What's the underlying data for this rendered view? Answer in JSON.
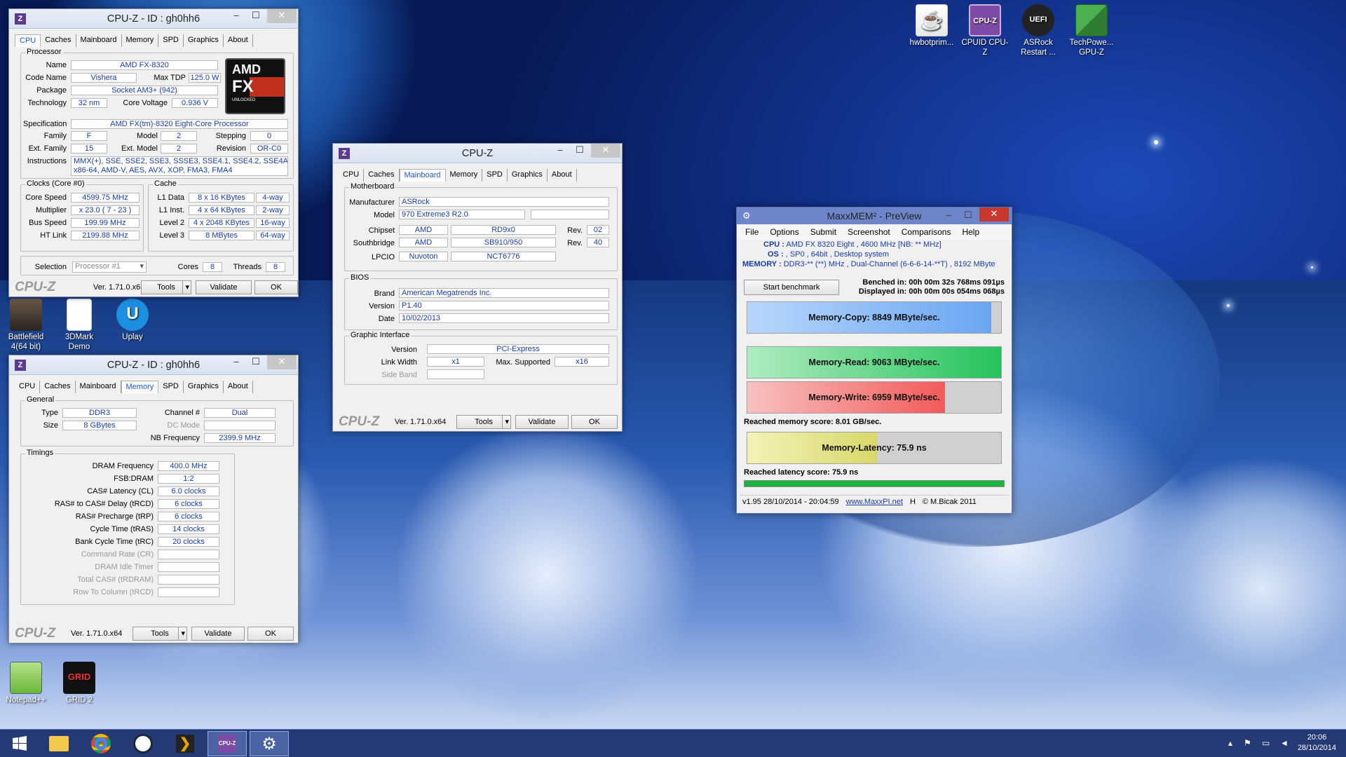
{
  "desktop": {
    "icons_top": [
      {
        "label": "hwbotprim...",
        "icon": "java-icon"
      },
      {
        "label": "CPUID CPU-Z",
        "icon": "cpuz-icon"
      },
      {
        "label": "ASRock Restart ...",
        "icon": "uefi-icon"
      },
      {
        "label": "TechPowe... GPU-Z",
        "icon": "gpuz-icon"
      }
    ],
    "icons_left": [
      {
        "label": "Battlefield 4(64 bit)",
        "icon": "battlefield-icon"
      },
      {
        "label": "3DMark Demo",
        "icon": "document-icon"
      },
      {
        "label": "Uplay",
        "icon": "uplay-icon"
      },
      {
        "label": "Notepad++",
        "icon": "notepad-icon"
      },
      {
        "label": "GRID 2",
        "icon": "grid2-icon"
      }
    ]
  },
  "cpuz_cpu": {
    "title": "CPU-Z  -  ID : gh0hh6",
    "tabs": [
      "CPU",
      "Caches",
      "Mainboard",
      "Memory",
      "SPD",
      "Graphics",
      "About"
    ],
    "active_tab": "CPU",
    "processor_group": "Processor",
    "name_label": "Name",
    "name": "AMD FX-8320",
    "code_name_label": "Code Name",
    "code_name": "Vishera",
    "max_tdp_label": "Max TDP",
    "max_tdp": "125.0 W",
    "package_label": "Package",
    "package": "Socket AM3+ (942)",
    "technology_label": "Technology",
    "technology": "32 nm",
    "core_voltage_label": "Core Voltage",
    "core_voltage": "0.936 V",
    "specification_label": "Specification",
    "specification": "AMD FX(tm)-8320 Eight-Core Processor",
    "family_label": "Family",
    "family": "F",
    "model_label": "Model",
    "model": "2",
    "stepping_label": "Stepping",
    "stepping": "0",
    "ext_family_label": "Ext. Family",
    "ext_family": "15",
    "ext_model_label": "Ext. Model",
    "ext_model": "2",
    "revision_label": "Revision",
    "revision": "OR-C0",
    "instructions_label": "Instructions",
    "instructions_line1": "MMX(+), SSE, SSE2, SSE3, SSSE3, SSE4.1, SSE4.2, SSE4A,",
    "instructions_line2": "x86-64, AMD-V, AES, AVX, XOP, FMA3, FMA4",
    "clocks_group": "Clocks (Core #0)",
    "core_speed_label": "Core Speed",
    "core_speed": "4599.75 MHz",
    "multiplier_label": "Multiplier",
    "multiplier": "x 23.0 ( 7 - 23 )",
    "bus_speed_label": "Bus Speed",
    "bus_speed": "199.99 MHz",
    "ht_link_label": "HT Link",
    "ht_link": "2199.88 MHz",
    "cache_group": "Cache",
    "l1d_label": "L1 Data",
    "l1d": "8 x 16 KBytes",
    "l1d_way": "4-way",
    "l1i_label": "L1 Inst.",
    "l1i": "4 x 64 KBytes",
    "l1i_way": "2-way",
    "l2_label": "Level 2",
    "l2": "4 x 2048 KBytes",
    "l2_way": "16-way",
    "l3_label": "Level 3",
    "l3": "8 MBytes",
    "l3_way": "64-way",
    "selection_label": "Selection",
    "selection": "Processor #1",
    "cores_label": "Cores",
    "cores": "8",
    "threads_label": "Threads",
    "threads": "8",
    "brand_mark": "CPU-Z",
    "version": "Ver. 1.71.0.x64",
    "tools": "Tools",
    "validate": "Validate",
    "ok": "OK",
    "amd_logo_text": "AMD",
    "fx_logo_text": "FX",
    "fx_logo_sub": "UNLOCKED"
  },
  "cpuz_mem": {
    "title": "CPU-Z  -  ID : gh0hh6",
    "tabs": [
      "CPU",
      "Caches",
      "Mainboard",
      "Memory",
      "SPD",
      "Graphics",
      "About"
    ],
    "active_tab": "Memory",
    "general_group": "General",
    "type_label": "Type",
    "type": "DDR3",
    "channel_label": "Channel #",
    "channel": "Dual",
    "size_label": "Size",
    "size": "8 GBytes",
    "dc_mode_label": "DC Mode",
    "nb_freq_label": "NB Frequency",
    "nb_freq": "2399.9 MHz",
    "timings_group": "Timings",
    "timings": [
      {
        "label": "DRAM Frequency",
        "value": "400.0 MHz",
        "enabled": true
      },
      {
        "label": "FSB:DRAM",
        "value": "1:2",
        "enabled": true
      },
      {
        "label": "CAS# Latency (CL)",
        "value": "6.0 clocks",
        "enabled": true
      },
      {
        "label": "RAS# to CAS# Delay (tRCD)",
        "value": "6 clocks",
        "enabled": true
      },
      {
        "label": "RAS# Precharge (tRP)",
        "value": "6 clocks",
        "enabled": true
      },
      {
        "label": "Cycle Time (tRAS)",
        "value": "14 clocks",
        "enabled": true
      },
      {
        "label": "Bank Cycle Time (tRC)",
        "value": "20 clocks",
        "enabled": true
      },
      {
        "label": "Command Rate (CR)",
        "value": "",
        "enabled": false
      },
      {
        "label": "DRAM Idle Timer",
        "value": "",
        "enabled": false
      },
      {
        "label": "Total CAS# (tRDRAM)",
        "value": "",
        "enabled": false
      },
      {
        "label": "Row To Column (tRCD)",
        "value": "",
        "enabled": false
      }
    ],
    "brand_mark": "CPU-Z",
    "version": "Ver. 1.71.0.x64",
    "tools": "Tools",
    "validate": "Validate",
    "ok": "OK"
  },
  "cpuz_mb": {
    "title": "CPU-Z",
    "tabs": [
      "CPU",
      "Caches",
      "Mainboard",
      "Memory",
      "SPD",
      "Graphics",
      "About"
    ],
    "active_tab": "Mainboard",
    "motherboard_group": "Motherboard",
    "manufacturer_label": "Manufacturer",
    "manufacturer": "ASRock",
    "model_label": "Model",
    "model": "970 Extreme3 R2.0",
    "chipset_label": "Chipset",
    "chipset_vendor": "AMD",
    "chipset": "RD9x0",
    "chipset_rev_label": "Rev.",
    "chipset_rev": "02",
    "southbridge_label": "Southbridge",
    "sb_vendor": "AMD",
    "sb": "SB910/950",
    "sb_rev_label": "Rev.",
    "sb_rev": "40",
    "lpcio_label": "LPCIO",
    "lpcio_vendor": "Nuvoton",
    "lpcio": "NCT6776",
    "bios_group": "BIOS",
    "brand_label": "Brand",
    "brand": "American Megatrends Inc.",
    "version_label": "Version",
    "bios_version": "P1.40",
    "date_label": "Date",
    "date": "10/02/2013",
    "graphic_group": "Graphic Interface",
    "gi_version_label": "Version",
    "gi_version": "PCI-Express",
    "link_width_label": "Link Width",
    "link_width": "x1",
    "max_supported_label": "Max. Supported",
    "max_supported": "x16",
    "side_band_label": "Side Band",
    "brand_mark": "CPU-Z",
    "version": "Ver. 1.71.0.x64",
    "tools": "Tools",
    "validate": "Validate",
    "ok": "OK"
  },
  "maxxmem": {
    "title": "MaxxMEM² - PreView",
    "menu": [
      "File",
      "Options",
      "Submit",
      "Screenshot",
      "Comparisons",
      "Help"
    ],
    "cpu_label": "CPU :",
    "cpu": "AMD FX 8320 Eight , 4600 MHz  [NB: ** MHz]",
    "os_label": "OS :",
    "os": ", SP0 , 64bit , Desktop system",
    "memory_label": "MEMORY :",
    "memory": "DDR3-** (**) MHz , Dual-Channel (6-6-6-14-**T) , 8192 MByte",
    "start_button": "Start benchmark",
    "benched": "Benched in: 00h 00m 32s 768ms 091µs",
    "displayed": "Displayed in: 00h 00m 00s 054ms 068µs",
    "copy": "Memory-Copy: 8849 MByte/sec.",
    "copy_fill": 0.96,
    "read": "Memory-Read: 9063 MByte/sec.",
    "read_fill": 1.0,
    "write": "Memory-Write: 6959 MByte/sec.",
    "write_fill": 0.78,
    "memory_score": "Reached memory score: 8.01 GB/sec.",
    "latency": "Memory-Latency: 75.9 ns",
    "latency_fill": 0.51,
    "latency_score": "Reached latency score: 75.9 ns",
    "status_version": "v1.95  28/10/2014 - 20:04:59",
    "status_link": "www.MaxxPI.net",
    "status_h": "H",
    "status_copyright": "© M.Bicak 2011"
  },
  "taskbar": {
    "apps": [
      "start",
      "explorer",
      "chrome",
      "steam",
      "plex",
      "cpuz",
      "settings"
    ],
    "time": "20:06",
    "date": "28/10/2014"
  },
  "colors": {
    "copy": "#6aa6f2",
    "read": "#2ec860",
    "write": "#f35a5a",
    "latency": "#e8e88c",
    "link": "#1a3ca8",
    "progress": "#18b340"
  }
}
